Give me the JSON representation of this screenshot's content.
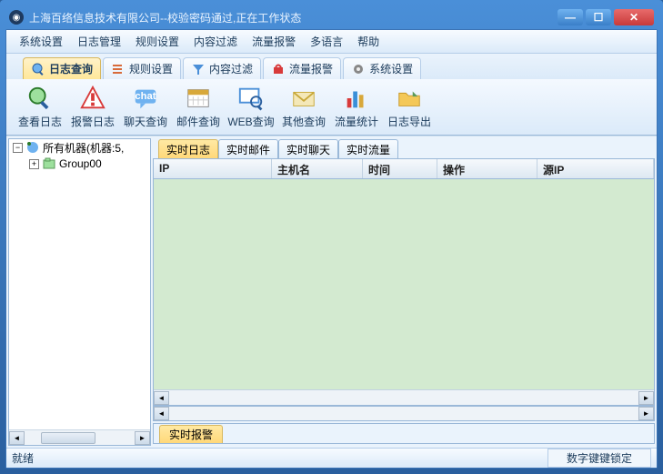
{
  "window": {
    "title": "上海百络信息技术有限公司--校验密码通过,正在工作状态"
  },
  "menu": {
    "items": [
      "系统设置",
      "日志管理",
      "规则设置",
      "内容过滤",
      "流量报警",
      "多语言",
      "帮助"
    ]
  },
  "ribbon_tabs": [
    {
      "label": "日志查询",
      "active": true,
      "icon": "search-log"
    },
    {
      "label": "规则设置",
      "active": false,
      "icon": "rule"
    },
    {
      "label": "内容过滤",
      "active": false,
      "icon": "filter"
    },
    {
      "label": "流量报警",
      "active": false,
      "icon": "alarm"
    },
    {
      "label": "系统设置",
      "active": false,
      "icon": "gear"
    }
  ],
  "toolbar": [
    {
      "label": "查看日志",
      "icon": "magnifier"
    },
    {
      "label": "报警日志",
      "icon": "warning"
    },
    {
      "label": "聊天查询",
      "icon": "chat"
    },
    {
      "label": "邮件查询",
      "icon": "calendar"
    },
    {
      "label": "WEB查询",
      "icon": "web-search"
    },
    {
      "label": "其他查询",
      "icon": "envelope"
    },
    {
      "label": "流量统计",
      "icon": "chart"
    },
    {
      "label": "日志导出",
      "icon": "folder"
    }
  ],
  "tree": {
    "root_label": "所有机器(机器:5,",
    "child_label": "Group00"
  },
  "inner_tabs": [
    "实时日志",
    "实时邮件",
    "实时聊天",
    "实时流量"
  ],
  "grid_columns": [
    "IP",
    "主机名",
    "时间",
    "操作",
    "源IP"
  ],
  "alarm_tab": "实时报警",
  "statusbar": {
    "left": "就绪",
    "right": "数字键键锁定"
  }
}
